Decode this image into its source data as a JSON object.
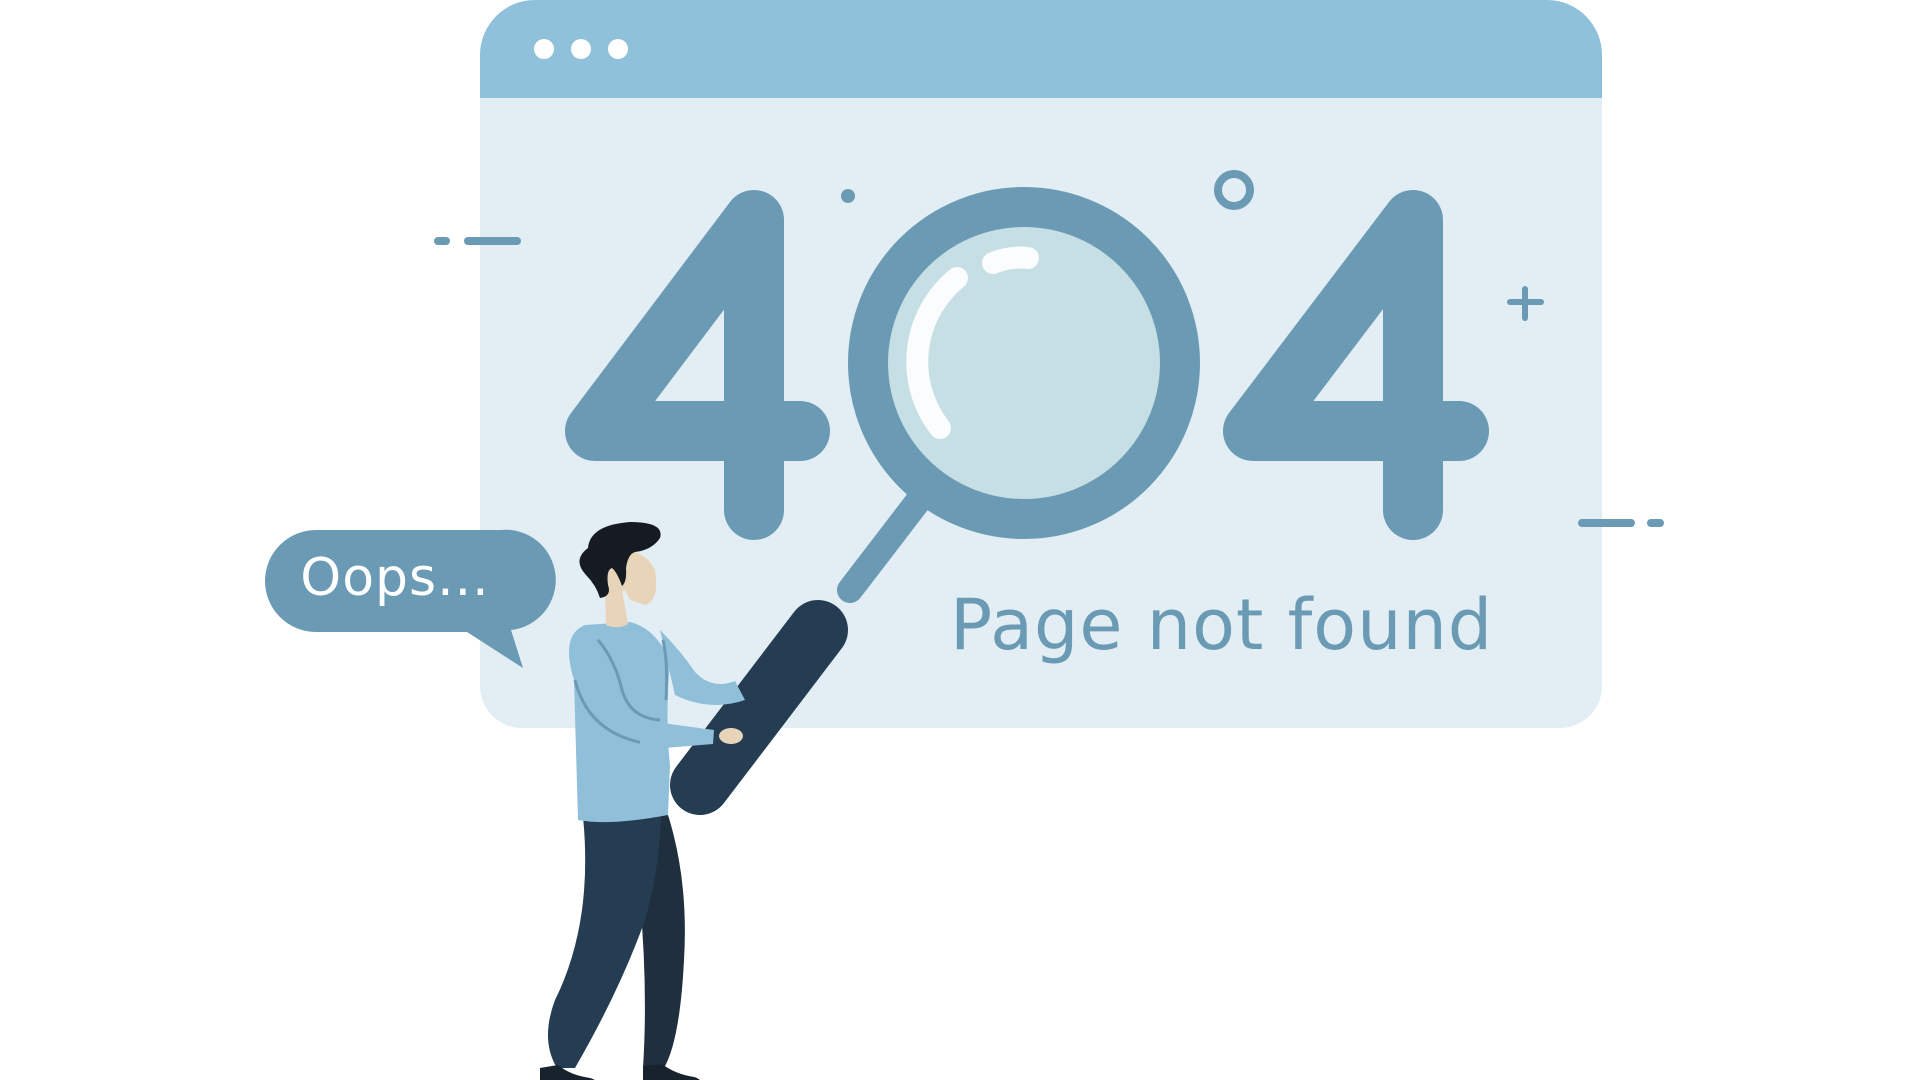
{
  "error_code": "404",
  "message": "Page not found",
  "speech_bubble": "Oops...",
  "colors": {
    "window_header": "#90c1da",
    "window_body": "#e2eef4",
    "accent": "#6a9ab4",
    "lens": "#c6dfe4",
    "dark_navy": "#243d52",
    "white": "#ffffff"
  },
  "icons": [
    "window-dots-icon",
    "magnifying-glass-icon",
    "plus-sparkle-icon",
    "ring-sparkle-icon",
    "dash-lines-icon"
  ]
}
